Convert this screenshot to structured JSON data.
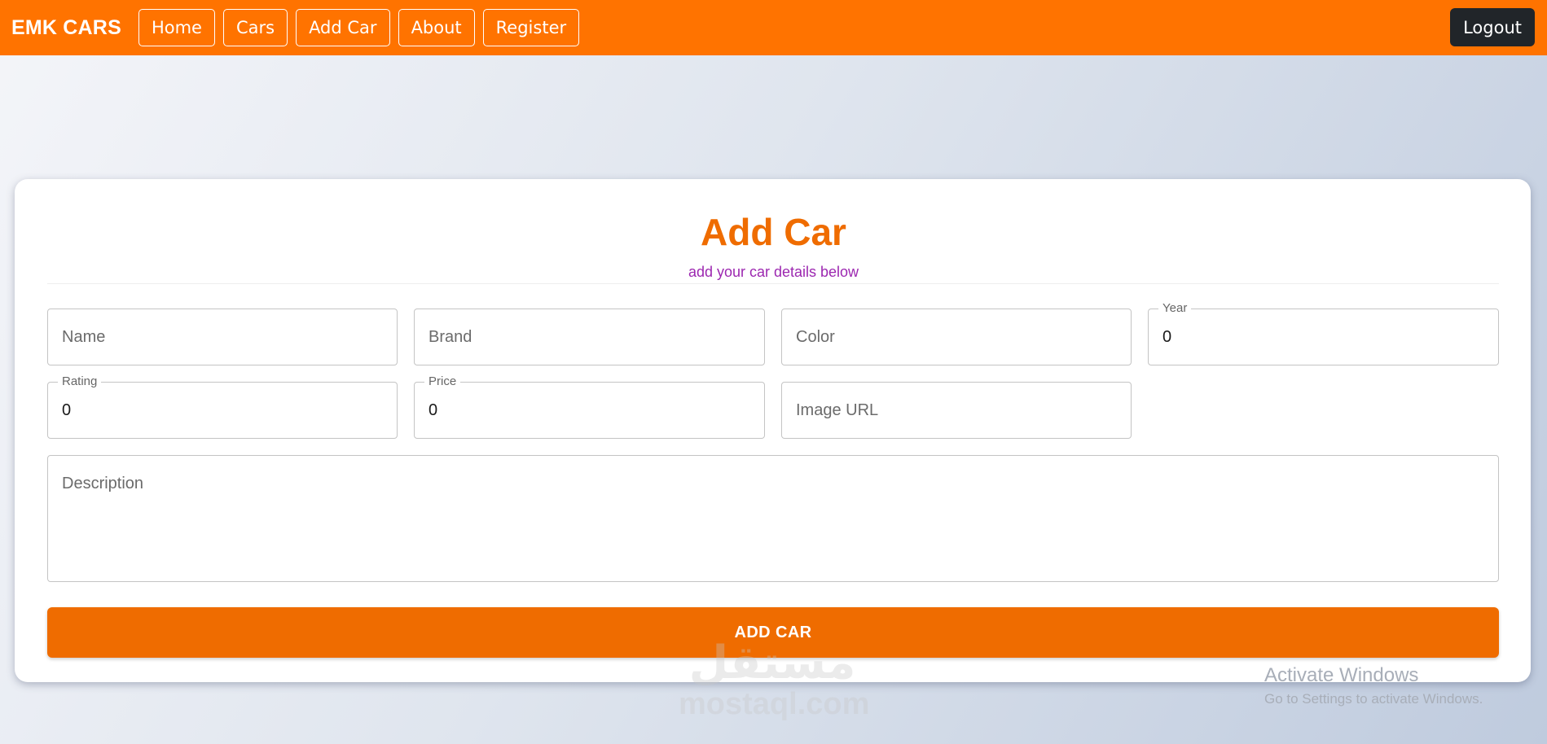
{
  "navbar": {
    "brand": "EMK CARS",
    "links": [
      "Home",
      "Cars",
      "Add Car",
      "About",
      "Register"
    ],
    "logout_label": "Logout",
    "accent_color": "#ff7300"
  },
  "form": {
    "title": "Add Car",
    "subtitle": "add your car details below",
    "fields": {
      "name": {
        "placeholder": "Name",
        "value": ""
      },
      "brand": {
        "placeholder": "Brand",
        "value": ""
      },
      "color": {
        "placeholder": "Color",
        "value": ""
      },
      "year": {
        "label": "Year",
        "value": "0"
      },
      "rating": {
        "label": "Rating",
        "value": "0"
      },
      "price": {
        "label": "Price",
        "value": "0"
      },
      "image_url": {
        "placeholder": "Image URL",
        "value": ""
      },
      "description": {
        "placeholder": "Description",
        "value": ""
      }
    },
    "submit_label": "ADD CAR",
    "title_color": "#ef6c00",
    "subtitle_color": "#9c27b0"
  },
  "watermark": {
    "arabic": "مستقل",
    "text": "mostaql.com"
  },
  "os_notice": {
    "title": "Activate Windows",
    "detail": "Go to Settings to activate Windows."
  }
}
